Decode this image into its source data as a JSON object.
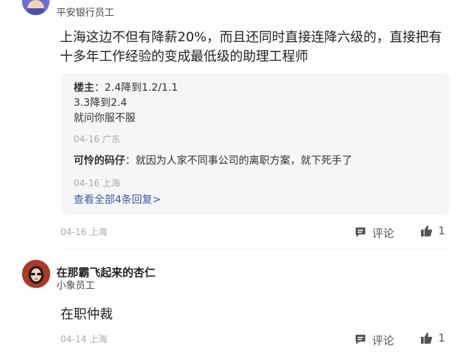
{
  "comment1": {
    "author_name": "",
    "author_role": "平安银行员工",
    "text": "上海这边不但有降薪20%，而且还同时直接连降六级的，直接把有十多年工作经验的变成最低级的助理工程师",
    "replies": [
      {
        "name": "楼主",
        "sep": "：",
        "lines": [
          "2.4降到1.2/1.1",
          "3.3降到2.4",
          "就问你服不服"
        ],
        "meta": "04-16 广东"
      },
      {
        "name": "可怜的码仔",
        "sep": "：",
        "lines": [
          "就因为人家不同事公司的离职方案，就下死手了"
        ],
        "meta": "04-16 上海"
      }
    ],
    "more_replies": "查看全部4条回复>",
    "meta": "04-16 上海",
    "comment_label": "评论",
    "like_count": "1"
  },
  "comment2": {
    "author_name": "在那霸飞起来的杏仁",
    "author_role": "小象员工",
    "text": "在职仲裁",
    "meta": "04-14 上海",
    "comment_label": "评论",
    "like_count": "1"
  },
  "icons": {
    "comment": "comment-bubble-icon",
    "like": "thumbs-up-icon"
  },
  "colors": {
    "link": "#3a5aa8",
    "meta_gray": "#aaaaaa",
    "reply_bg": "#f5f6f8"
  }
}
